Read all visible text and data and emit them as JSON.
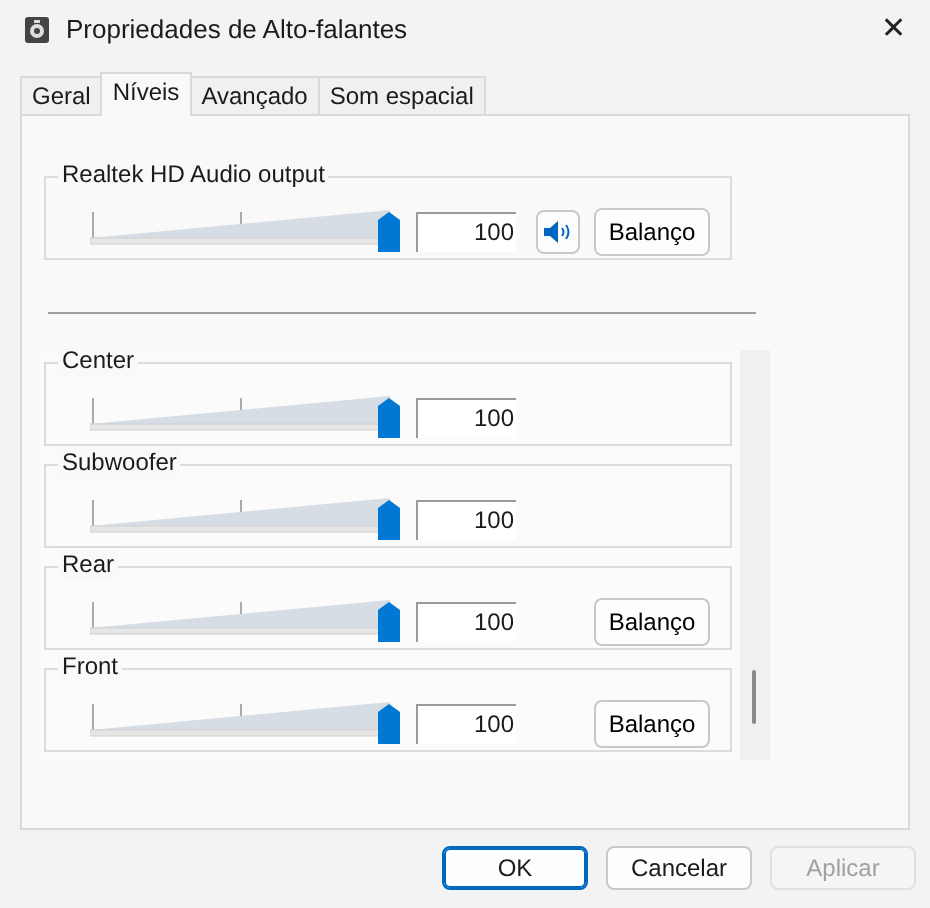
{
  "window": {
    "title": "Propriedades de Alto-falantes",
    "close": "✕"
  },
  "tabs": [
    {
      "label": "Geral",
      "selected": false
    },
    {
      "label": "Níveis",
      "selected": true
    },
    {
      "label": "Avançado",
      "selected": false
    },
    {
      "label": "Som espacial",
      "selected": false
    }
  ],
  "master": {
    "name": "Realtek HD Audio output",
    "level": 1,
    "reading": "100",
    "muted": false,
    "balance": "Balanço"
  },
  "channels": [
    {
      "name": "Center",
      "level": 1,
      "reading": "100"
    },
    {
      "name": "Subwoofer",
      "level": 1,
      "reading": "100"
    },
    {
      "name": "Rear",
      "level": 1,
      "reading": "100",
      "balance": "Balanço"
    },
    {
      "name": "Front",
      "level": 1,
      "reading": "100",
      "balance": "Balanço"
    }
  ],
  "buttons": [
    {
      "label": "OK",
      "kind": "default",
      "disabled": false
    },
    {
      "label": "Cancelar",
      "kind": "normal",
      "disabled": false
    },
    {
      "label": "Aplicar",
      "kind": "normal",
      "disabled": true
    }
  ]
}
